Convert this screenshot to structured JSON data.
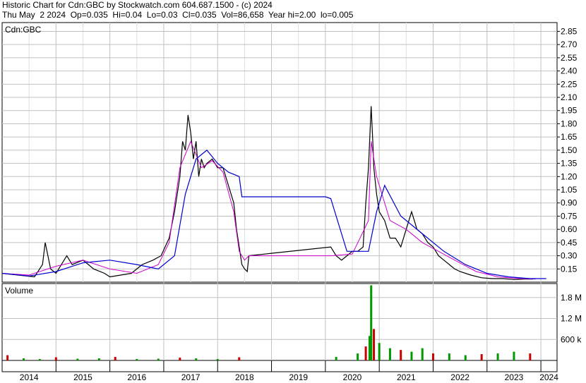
{
  "header": {
    "line1": "Historic Chart for Cdn:GBC by Stockwatch.com 604.687.1500 - (c) 2024",
    "line2": "Thu May  2 2024  Op=0.035  Hi=0.04  Lo=0.03  Cl=0.035  Vol=86,658  Year hi=2.00  lo=0.005"
  },
  "chart_data": {
    "type": "line",
    "symbol_label": "Cdn:GBC",
    "volume_label": "Volume",
    "price_ticks": [
      "2.85",
      "2.70",
      "2.55",
      "2.40",
      "2.25",
      "2.10",
      "1.95",
      "1.80",
      "1.65",
      "1.50",
      "1.35",
      "1.20",
      "1.05",
      "0.90",
      "0.75",
      "0.60",
      "0.45",
      "0.30",
      "0.15"
    ],
    "volume_ticks": [
      "1.8 M",
      "1.2 M",
      "600 k"
    ],
    "x_labels": [
      "2014",
      "2015",
      "2016",
      "2017",
      "2018",
      "2019",
      "2020",
      "2021",
      "2022",
      "2023",
      "2024"
    ],
    "price_ylim": [
      0,
      2.95
    ],
    "volume_ylim": [
      0,
      2200000
    ],
    "grid": true,
    "colors": {
      "price": "#000000",
      "ma_short": "#cc00cc",
      "ma_long": "#0000cc",
      "vol_up": "#009900",
      "vol_down": "#cc0000",
      "grid": "#c0c0c0"
    },
    "series": [
      {
        "name": "",
        "style": "price",
        "x": [
          2014.0,
          2014.3,
          2014.6,
          2014.75,
          2014.8,
          2014.9,
          2015.0,
          2015.2,
          2015.3,
          2015.5,
          2015.7,
          2015.9,
          2016.0,
          2016.2,
          2016.4,
          2016.6,
          2016.8,
          2016.95,
          2017.1,
          2017.2,
          2017.3,
          2017.35,
          2017.4,
          2017.45,
          2017.5,
          2017.55,
          2017.6,
          2017.65,
          2017.7,
          2017.75,
          2017.8,
          2017.9,
          2018.0,
          2018.1,
          2018.2,
          2018.3,
          2018.35,
          2018.4,
          2018.45,
          2018.5,
          2018.55,
          2018.58,
          2020.1,
          2020.2,
          2020.3,
          2020.4,
          2020.5,
          2020.6,
          2020.7,
          2020.75,
          2020.8,
          2020.85,
          2020.88,
          2020.9,
          2020.95,
          2021.0,
          2021.1,
          2021.2,
          2021.3,
          2021.4,
          2021.5,
          2021.6,
          2021.7,
          2021.8,
          2021.9,
          2022.0,
          2022.1,
          2022.2,
          2022.3,
          2022.4,
          2022.5,
          2022.7,
          2022.9,
          2023.1,
          2023.3,
          2023.5,
          2023.7,
          2023.85
        ],
        "y": [
          0.1,
          0.08,
          0.06,
          0.2,
          0.45,
          0.15,
          0.1,
          0.3,
          0.2,
          0.25,
          0.15,
          0.1,
          0.06,
          0.08,
          0.1,
          0.2,
          0.25,
          0.3,
          0.5,
          0.8,
          1.2,
          1.6,
          1.5,
          1.9,
          1.7,
          1.4,
          1.6,
          1.2,
          1.4,
          1.3,
          1.35,
          1.4,
          1.3,
          1.3,
          1.1,
          0.9,
          0.6,
          0.4,
          0.2,
          0.15,
          0.12,
          0.3,
          0.4,
          0.3,
          0.25,
          0.3,
          0.35,
          0.35,
          0.4,
          0.9,
          1.3,
          2.0,
          1.6,
          1.3,
          1.0,
          0.8,
          0.7,
          0.5,
          0.5,
          0.4,
          0.6,
          0.8,
          0.6,
          0.55,
          0.45,
          0.4,
          0.3,
          0.25,
          0.2,
          0.15,
          0.12,
          0.08,
          0.05,
          0.04,
          0.04,
          0.03,
          0.035,
          0.035
        ]
      },
      {
        "name": "",
        "style": "ma_short",
        "x": [
          2014.0,
          2014.5,
          2015.0,
          2015.5,
          2016.0,
          2016.5,
          2016.9,
          2017.1,
          2017.3,
          2017.5,
          2017.7,
          2017.9,
          2018.1,
          2018.3,
          2018.4,
          2018.5,
          2018.58,
          2020.1,
          2020.5,
          2020.8,
          2020.85,
          2020.95,
          2021.2,
          2021.5,
          2021.8,
          2022.1,
          2022.4,
          2022.8,
          2023.2,
          2023.6,
          2023.9
        ],
        "y": [
          0.1,
          0.08,
          0.18,
          0.25,
          0.15,
          0.1,
          0.2,
          0.45,
          1.3,
          1.6,
          1.3,
          1.38,
          1.25,
          0.8,
          0.35,
          0.25,
          0.3,
          0.3,
          0.32,
          0.7,
          1.6,
          1.2,
          0.7,
          0.6,
          0.45,
          0.35,
          0.25,
          0.12,
          0.06,
          0.04,
          0.035
        ]
      },
      {
        "name": "",
        "style": "ma_long",
        "x": [
          2014.0,
          2014.5,
          2015.0,
          2015.5,
          2016.0,
          2016.5,
          2016.9,
          2017.2,
          2017.4,
          2017.6,
          2017.8,
          2018.0,
          2018.2,
          2018.4,
          2018.45,
          2019.0,
          2020.0,
          2020.1,
          2020.4,
          2020.8,
          2020.95,
          2021.1,
          2021.4,
          2021.8,
          2022.2,
          2022.6,
          2023.0,
          2023.4,
          2023.8,
          2024.1
        ],
        "y": [
          0.1,
          0.07,
          0.12,
          0.22,
          0.25,
          0.2,
          0.15,
          0.3,
          1.0,
          1.4,
          1.5,
          1.35,
          1.25,
          1.2,
          0.97,
          0.97,
          0.97,
          0.95,
          0.35,
          0.35,
          0.8,
          1.1,
          0.75,
          0.55,
          0.35,
          0.2,
          0.1,
          0.06,
          0.04,
          0.04
        ]
      }
    ],
    "volume": {
      "x": [
        2014.1,
        2014.4,
        2014.7,
        2015.0,
        2015.4,
        2015.8,
        2016.1,
        2016.5,
        2016.9,
        2017.3,
        2017.6,
        2018.0,
        2018.4,
        2020.2,
        2020.6,
        2020.75,
        2020.82,
        2020.85,
        2020.9,
        2021.0,
        2021.2,
        2021.4,
        2021.6,
        2021.8,
        2022.0,
        2022.3,
        2022.6,
        2022.9,
        2023.2,
        2023.5,
        2023.8
      ],
      "values": [
        150000,
        60000,
        40000,
        90000,
        50000,
        60000,
        100000,
        40000,
        50000,
        80000,
        60000,
        40000,
        90000,
        100000,
        200000,
        400000,
        700000,
        2150000,
        900000,
        500000,
        350000,
        300000,
        250000,
        350000,
        200000,
        200000,
        150000,
        180000,
        200000,
        250000,
        200000
      ]
    }
  }
}
